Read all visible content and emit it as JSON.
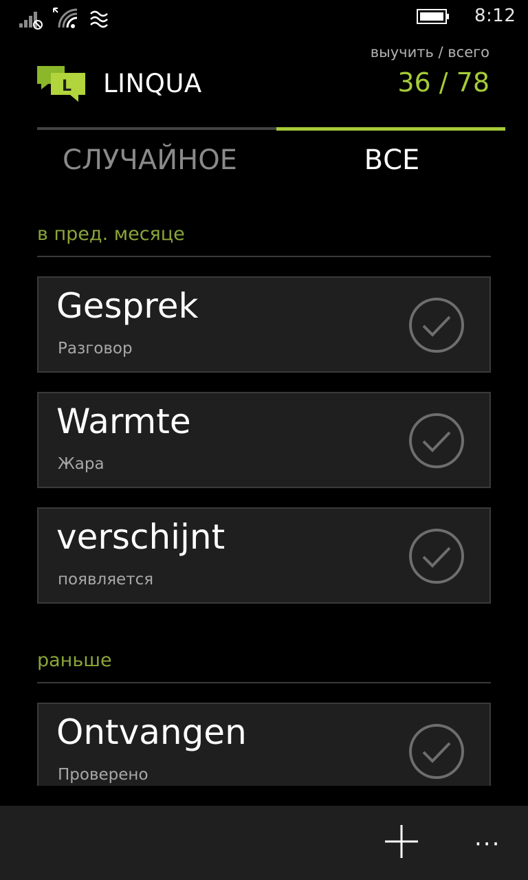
{
  "status": {
    "time": "8:12"
  },
  "header": {
    "app_name": "LINQUA",
    "logo_letter": "L",
    "counter_caption": "выучить / всего",
    "counter_value": "36 / 78"
  },
  "tabs": [
    {
      "label": "СЛУЧАЙНОЕ",
      "active": false
    },
    {
      "label": "ВСЕ",
      "active": true
    }
  ],
  "sections": [
    {
      "title": "в пред. месяце",
      "items": [
        {
          "word": "Gesprek",
          "translation": "Разговор"
        },
        {
          "word": "Warmte",
          "translation": "Жара"
        },
        {
          "word": "verschijnt",
          "translation": "появляется"
        }
      ]
    },
    {
      "title": "раньше",
      "items": [
        {
          "word": "Ontvangen",
          "translation": "Проверено"
        }
      ]
    }
  ],
  "app_bar": {
    "more_label": "···"
  },
  "colors": {
    "accent": "#a6cc38",
    "section": "#8aa63a",
    "card_bg": "#1f1f1f"
  },
  "icons": [
    "signal-icon",
    "wifi-icon",
    "data-icon",
    "battery-icon",
    "linqua-logo-icon",
    "check-circle-icon",
    "plus-icon"
  ]
}
